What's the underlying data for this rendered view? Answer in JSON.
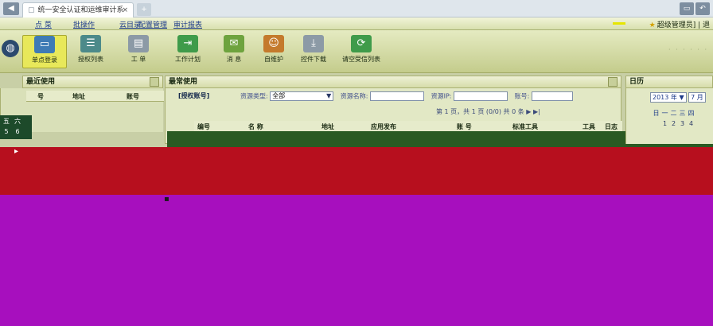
{
  "browser": {
    "tab_title": "统一安全认证和运维审计系统",
    "tab_close": "×",
    "tab_new": "+",
    "back_icon": "◀",
    "window_buttons": [
      "▭",
      "↶"
    ]
  },
  "top_nav": {
    "items": [
      "点 菜",
      "批操作",
      "云目录",
      "配置管理",
      "审计报表"
    ],
    "user_info": "超级管理员] | 退"
  },
  "toolbar": {
    "items": [
      {
        "label": "单点登录",
        "icon": "monitor-icon",
        "active": true
      },
      {
        "label": "授权列表",
        "icon": "list-icon"
      },
      {
        "label": "工 单",
        "icon": "form-icon"
      },
      {
        "label": "工作计划",
        "icon": "plan-icon"
      },
      {
        "label": "消 息",
        "icon": "message-icon"
      },
      {
        "label": "自维护",
        "icon": "user-card-icon"
      },
      {
        "label": "控件下载",
        "icon": "download-icon"
      },
      {
        "label": "请空受信列表",
        "icon": "refresh-icon"
      }
    ]
  },
  "recent": {
    "title": "最近使用",
    "columns": [
      "号",
      "地址",
      "账号"
    ]
  },
  "main": {
    "title": "最常使用",
    "auth_tab": "[授权账号]",
    "filters": {
      "resource_type_label": "资源类型:",
      "resource_type_value": "全部",
      "resource_name_label": "资源名称:",
      "resource_ip_label": "资源IP:",
      "account_label": "账号:"
    },
    "pager": "第 1 页，共 1 页 (0/0) 共 0 条",
    "columns": [
      "编号",
      "名 称",
      "地址",
      "应用发布",
      "账 号",
      "标准工具",
      "工具",
      "日志"
    ]
  },
  "calendar": {
    "title": "日历",
    "year": "2013 年",
    "month": "7 月",
    "weekdays": [
      "日",
      "一",
      "二",
      "三",
      "四"
    ],
    "days": [
      "1",
      "2",
      "3",
      "4"
    ],
    "side_weekdays": [
      "五",
      "六"
    ],
    "side_days": [
      "5",
      "6"
    ]
  },
  "colors": {
    "red_block": "#b70f1e",
    "purple_block": "#a70fbe",
    "green_strip": "#2a5a23"
  }
}
